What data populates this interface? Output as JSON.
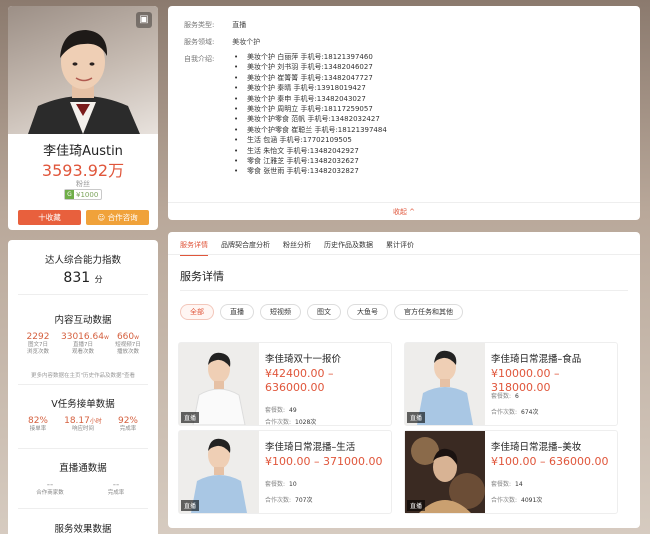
{
  "profile": {
    "name": "李佳琦Austin",
    "fans_count": "3593.92万",
    "fans_label": "粉丝",
    "price_badge": "¥1000",
    "favorite_button": "十收藏",
    "coop_button": "合作咨询"
  },
  "info": {
    "service_type_label": "服务类型:",
    "service_type_value": "直播",
    "service_field_label": "服务领域:",
    "service_field_value": "美妆个护",
    "intro_label": "自我介绍:",
    "intro_items": [
      "美妆个护 白丽萍 手机号:18121397460",
      "美妆个护 刘书羽 手机号:13482046027",
      "美妆个护 崔箐箐 手机号:13482047727",
      "美妆个护 秦晴 手机号:13918019427",
      "美妆个护 秦申 手机号:13482043027",
      "美妆个护 周明立 手机号:18117259057",
      "美妆个护零食 范帆 手机号:13482032427",
      "美妆个护零食 崔聪兰 手机号:18121397484",
      "生活 包涵 手机号:17702109505",
      "生活 朱怡文 手机号:13482042927",
      "零食 江雅芝 手机号:13482032627",
      "零食 张世雨 手机号:13482032827"
    ],
    "collapse_label": "收起 ^"
  },
  "stats": {
    "ability_title": "达人综合能力指数",
    "ability_score": "831",
    "ability_unit": "分",
    "interaction_title": "内容互动数据",
    "interaction": [
      {
        "value": "2292",
        "unit": "",
        "label1": "图文7日",
        "label2": "浏览次数"
      },
      {
        "value": "33016.64",
        "unit": "w",
        "label1": "直播7日",
        "label2": "观看次数"
      },
      {
        "value": "660",
        "unit": "w",
        "label1": "短视频7日",
        "label2": "播放次数"
      }
    ],
    "interaction_note": "更多内容数据在主页\"历史作品及数据\"查看",
    "task_title": "V任务接单数据",
    "task": [
      {
        "value": "82%",
        "unit": "",
        "label1": "接单率"
      },
      {
        "value": "18.17",
        "unit": "小时",
        "label1": "响应时间"
      },
      {
        "value": "92%",
        "unit": "",
        "label1": "完成率"
      }
    ],
    "live_title": "直播通数据",
    "live": [
      {
        "value": "--",
        "label1": "合作商家数"
      },
      {
        "value": "--",
        "label1": "完成率"
      }
    ],
    "effect_title": "服务效果数据"
  },
  "detail": {
    "tabs": [
      "服务详情",
      "品牌契合度分析",
      "粉丝分析",
      "历史作品及数据",
      "累计评价"
    ],
    "section_title": "服务详情",
    "filters": [
      "全部",
      "直播",
      "短视频",
      "图文",
      "大鱼号",
      "官方任务和其他"
    ],
    "packages": [
      {
        "title": "李佳琦双十一报价",
        "price": "¥42400.00 – 636000.00",
        "meal_label": "套餐数:",
        "meal_value": "49",
        "coop_label": "合作次数:",
        "coop_value": "1028次",
        "tag": "直播"
      },
      {
        "title": "李佳琦日常混播–食品",
        "price": "¥10000.00 – 318000.00",
        "meal_label": "套餐数:",
        "meal_value": "6",
        "coop_label": "合作次数:",
        "coop_value": "674次",
        "tag": "直播"
      },
      {
        "title": "李佳琦日常混播–生活",
        "price": "¥100.00 – 371000.00",
        "meal_label": "套餐数:",
        "meal_value": "10",
        "coop_label": "合作次数:",
        "coop_value": "707次",
        "tag": "直播"
      },
      {
        "title": "李佳琦日常混播–美妆",
        "price": "¥100.00 – 636000.00",
        "meal_label": "套餐数:",
        "meal_value": "14",
        "coop_label": "合作次数:",
        "coop_value": "4091次",
        "tag": "直播"
      }
    ]
  },
  "colors": {
    "accent": "#e0563b",
    "coop": "#f0a23a"
  }
}
